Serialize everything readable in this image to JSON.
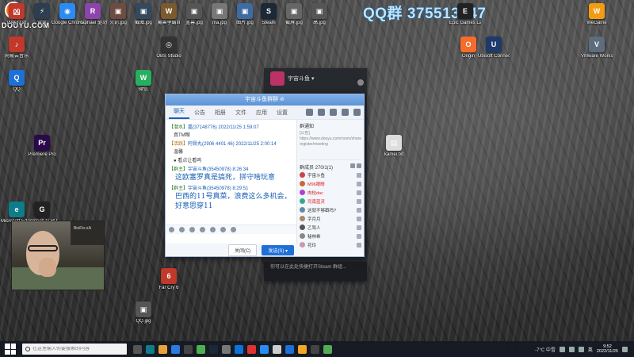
{
  "overlay": {
    "platform_logo_text": "DOUYU.COM",
    "qq_group": "QQ群 375513947"
  },
  "desktop_icons": [
    {
      "label": "凶猛行动",
      "color": "#c0392b",
      "glyph": "凶"
    },
    {
      "label": "雷霆",
      "color": "#2c3e50",
      "glyph": "⚡"
    },
    {
      "label": "Google Chrome",
      "color": "#2a8bf2",
      "glyph": "◉"
    },
    {
      "label": "Raphael 驱动",
      "color": "#8e44ad",
      "glyph": "R"
    },
    {
      "label": "火箭.jpg",
      "color": "#6d4c41",
      "glyph": "▣"
    },
    {
      "label": "截图.jpg",
      "color": "#34495e",
      "glyph": "▣"
    },
    {
      "label": "魔兽争霸III",
      "color": "#7b5a2e",
      "glyph": "W"
    },
    {
      "label": "蓝幕.jpg",
      "color": "#555",
      "glyph": "▣"
    },
    {
      "label": "ma.jpg",
      "color": "#777",
      "glyph": "▣"
    },
    {
      "label": "图片.jpg",
      "color": "#3f6ba5",
      "glyph": "▣"
    },
    {
      "label": "Steam",
      "color": "#1b2838",
      "glyph": "S"
    },
    {
      "label": "截屏.jpg",
      "color": "#666",
      "glyph": "▣"
    },
    {
      "label": "高.jpg",
      "color": "#555",
      "glyph": "▣"
    },
    {
      "label": "网易云音乐",
      "color": "#c0392b",
      "glyph": "♪"
    },
    {
      "label": "QQ",
      "color": "#1e6fd6",
      "glyph": "Q"
    },
    {
      "label": "微信",
      "color": "#27ae60",
      "glyph": "W"
    },
    {
      "label": "Premiere Pro",
      "color": "#2a0a4a",
      "glyph": "Pr"
    },
    {
      "label": "Logitech G HUB",
      "color": "#222",
      "glyph": "G"
    },
    {
      "label": "Microsoft Edge",
      "color": "#0e7d8a",
      "glyph": "e"
    },
    {
      "label": "OBS Studio",
      "color": "#333",
      "glyph": "◎"
    },
    {
      "label": "Epic Games Launcher",
      "color": "#222",
      "glyph": "E"
    },
    {
      "label": "WeGame",
      "color": "#f39c12",
      "glyph": "W"
    },
    {
      "label": "Origin",
      "color": "#f56c2d",
      "glyph": "O"
    },
    {
      "label": "Ubisoft Connect",
      "color": "#1d3a6b",
      "glyph": "U"
    },
    {
      "label": "VMware Workstation",
      "color": "#5d6d7e",
      "glyph": "V"
    },
    {
      "label": "kamei.txt",
      "color": "#ddd",
      "glyph": "▤"
    },
    {
      "label": "Far Cry 6",
      "color": "#c0392b",
      "glyph": "6"
    },
    {
      "label": "QQ.jpg",
      "color": "#555",
      "glyph": "▣"
    }
  ],
  "qq_window": {
    "title": "宇宙斗鱼群群 ⊘",
    "tabs": [
      "聊天",
      "公告",
      "相册",
      "文件",
      "应用",
      "设置"
    ],
    "messages": [
      {
        "role": "【潜水】",
        "nick": "嘉(37148776)",
        "time": "2022/11/25 1:59:07",
        "text": "真TM糊",
        "big": false
      },
      {
        "role": "【活跃】",
        "nick": "阿骨丸(2906 4401 46)",
        "time": "2022/11/25 2:00:14",
        "text": "温馨",
        "big": false
      },
      {
        "role": "",
        "nick": "",
        "time": "",
        "text": "● 看点让看呜",
        "big": false
      },
      {
        "role": "【群主】",
        "nick": "宇宙斗鱼(35450978)",
        "time": "8:26:34",
        "text": "这欧塞罗真是搞死，拼守啥玩意",
        "big": true
      },
      {
        "role": "【群主】",
        "nick": "宇宙斗鱼(35450978)",
        "time": "8:29:51",
        "text": "巴西的11号真菜，浪费这么多机会，好意思穿11",
        "big": true
      }
    ],
    "notice_title": "群通知",
    "notice_text": "[公告] https://www.douyu.com/room/share/2787... register/meeting",
    "members_label": "群成员 270/1(1)",
    "members": [
      {
        "name": "宇宙斗鱼",
        "red": false,
        "color": "#c44"
      },
      {
        "name": "M96眼睛",
        "red": true,
        "color": "#c63"
      },
      {
        "name": "肉桂dac",
        "red": true,
        "color": "#a4c"
      },
      {
        "name": "司南蓝灵",
        "red": true,
        "color": "#3a8"
      },
      {
        "name": "这就不够戳吗?",
        "red": false,
        "color": "#68a"
      },
      {
        "name": "字月月",
        "red": false,
        "color": "#a86"
      },
      {
        "name": "乙驾人",
        "red": false,
        "color": "#555"
      },
      {
        "name": "秘林希",
        "red": false,
        "color": "#888"
      },
      {
        "name": "花玲",
        "red": false,
        "color": "#c9a"
      }
    ],
    "close_label": "关闭(C)",
    "send_label": "发送(S) ▾"
  },
  "dark_window": {
    "user_name": "宇宙斗鱼 ▾",
    "toast_text": "你可以在此处快捷打开Steam 群组..."
  },
  "webcam": {
    "poster_text": "BioFlo.n/k"
  },
  "taskbar": {
    "search_placeholder": "在这里输入你要搜索的内容",
    "weather": "-7°C 中雪",
    "clock_time": "9:52",
    "clock_date": "2022/11/25",
    "language": "英",
    "app_colors": [
      "#555",
      "#0e7d8a",
      "#e9a23b",
      "#2c7be5",
      "#444",
      "#4caf50",
      "#1b2838",
      "#777",
      "#0b74da",
      "#d33",
      "#2a8bf2",
      "#ccc",
      "#1e6fd6",
      "#f5a623",
      "#444",
      "#5a5"
    ]
  }
}
